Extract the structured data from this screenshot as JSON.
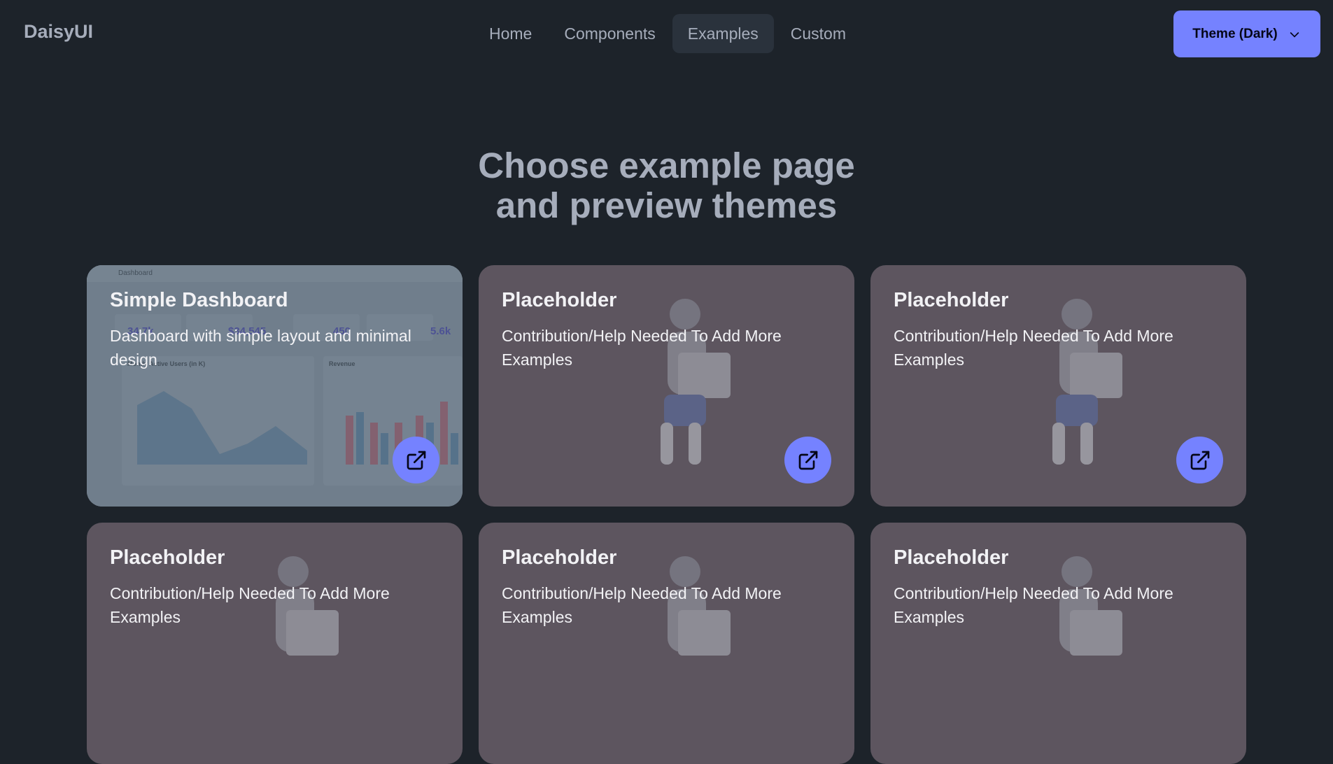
{
  "navbar": {
    "brand": "DaisyUI",
    "menu": [
      {
        "label": "Home"
      },
      {
        "label": "Components"
      },
      {
        "label": "Examples"
      },
      {
        "label": "Custom"
      }
    ],
    "theme_button": {
      "label": "Theme (Dark)",
      "icon": "chevron-down-icon"
    }
  },
  "hero": {
    "title_line1": "Choose example page",
    "title_line2": "and preview themes"
  },
  "dashboard_preview": {
    "header": "Dashboard",
    "stat_values": [
      "34.7k",
      "$34,545",
      "450",
      "5.6k"
    ],
    "chart_titles": [
      "Montly Active Users (in K)",
      "Revenue"
    ]
  },
  "cards": [
    {
      "title": "Simple Dashboard",
      "description": "Dashboard with simple layout and minimal design",
      "icon": "external-link-icon"
    },
    {
      "title": "Placeholder",
      "description": "Contribution/Help Needed To Add More Examples",
      "icon": "external-link-icon"
    },
    {
      "title": "Placeholder",
      "description": "Contribution/Help Needed To Add More Examples",
      "icon": "external-link-icon"
    },
    {
      "title": "Placeholder",
      "description": "Contribution/Help Needed To Add More Examples",
      "icon": "external-link-icon"
    },
    {
      "title": "Placeholder",
      "description": "Contribution/Help Needed To Add More Examples",
      "icon": "external-link-icon"
    },
    {
      "title": "Placeholder",
      "description": "Contribution/Help Needed To Add More Examples",
      "icon": "external-link-icon"
    }
  ],
  "colors": {
    "background": "#1d232a",
    "primary": "#7582ff",
    "card": "#5d555f",
    "text": "#a6adbb"
  }
}
